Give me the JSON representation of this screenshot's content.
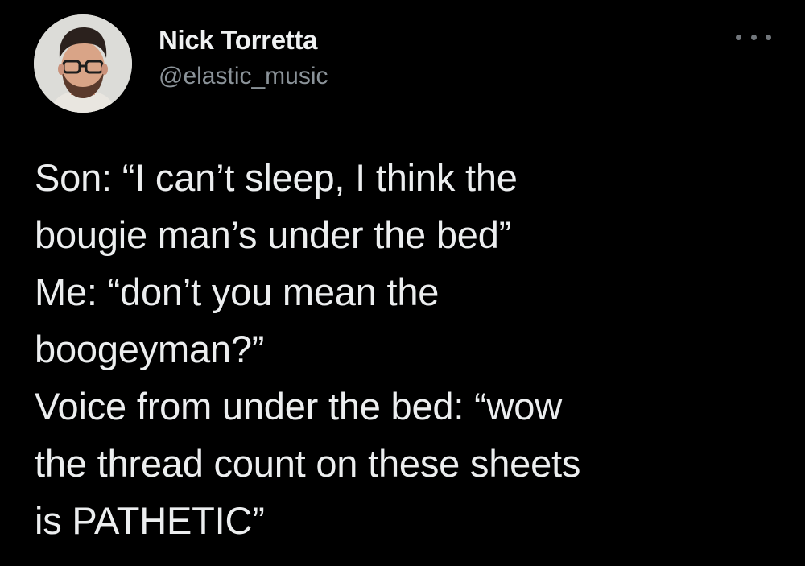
{
  "tweet": {
    "author": {
      "display_name": "Nick Torretta",
      "handle": "@elastic_music",
      "avatar_icon": "profile-photo"
    },
    "more_icon": "more-options-icon",
    "text_lines": [
      "Son: “I can’t sleep, I think the",
      "bougie man’s under the bed”",
      "Me: “don’t you mean the",
      "boogeyman?”",
      "Voice from under the bed: “wow",
      "the thread count on these sheets",
      "is PATHETIC”"
    ]
  },
  "colors": {
    "background": "#000000",
    "text": "#e7e9ea",
    "secondary_text": "#8b9399"
  }
}
